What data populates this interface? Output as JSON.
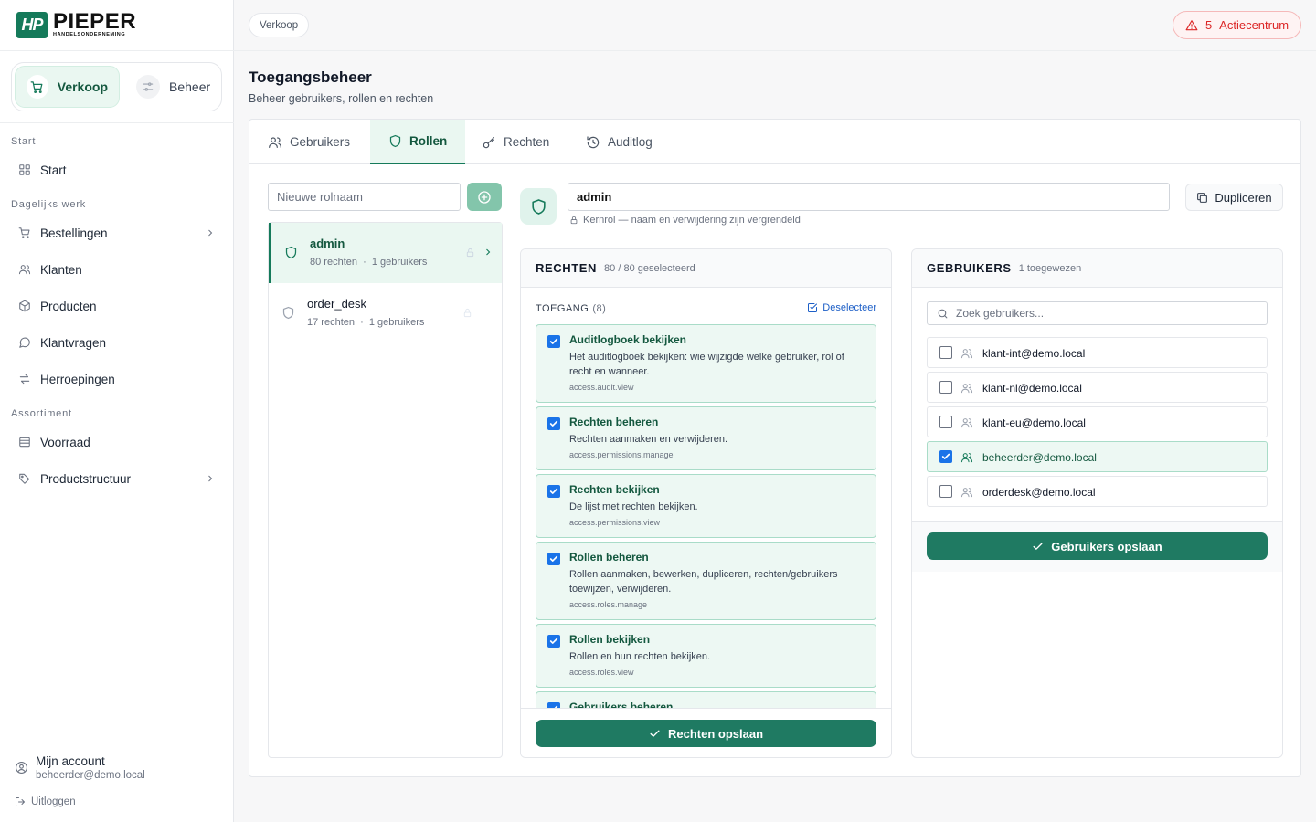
{
  "brand": {
    "mark": "HP",
    "name": "PIEPER",
    "tagline": "HANDELSONDERNEMING"
  },
  "switcher": {
    "sales": "Verkoop",
    "admin": "Beheer"
  },
  "sections": {
    "start": "Start",
    "daily": "Dagelijks werk",
    "assortment": "Assortiment"
  },
  "nav": {
    "start": "Start",
    "orders": "Bestellingen",
    "customers": "Klanten",
    "products": "Producten",
    "questions": "Klantvragen",
    "returns": "Herroepingen",
    "stock": "Voorraad",
    "structure": "Productstructuur"
  },
  "account": {
    "title": "Mijn account",
    "email": "beheerder@demo.local",
    "logout": "Uitloggen"
  },
  "breadcrumb": "Verkoop",
  "action_center": {
    "count": "5",
    "label": "Actiecentrum"
  },
  "page": {
    "title": "Toegangsbeheer",
    "subtitle": "Beheer gebruikers, rollen en rechten"
  },
  "tabs": {
    "users": "Gebruikers",
    "roles": "Rollen",
    "permissions": "Rechten",
    "audit": "Auditlog"
  },
  "new_role_placeholder": "Nieuwe rolnaam",
  "roles": [
    {
      "name": "admin",
      "perms": "80 rechten",
      "users": "1 gebruikers"
    },
    {
      "name": "order_desk",
      "perms": "17 rechten",
      "users": "1 gebruikers"
    }
  ],
  "selected_role": {
    "name": "admin",
    "hint": "Kernrol — naam en verwijdering zijn vergrendeld",
    "duplicate": "Dupliceren"
  },
  "rights_panel": {
    "title": "RECHTEN",
    "count": "80 / 80 geselecteerd",
    "group": "TOEGANG",
    "group_count": "(8)",
    "deselect": "Deselecteer",
    "save": "Rechten opslaan"
  },
  "permissions": [
    {
      "title": "Auditlogboek bekijken",
      "desc": "Het auditlogboek bekijken: wie wijzigde welke gebruiker, rol of recht en wanneer.",
      "key": "access.audit.view"
    },
    {
      "title": "Rechten beheren",
      "desc": "Rechten aanmaken en verwijderen.",
      "key": "access.permissions.manage"
    },
    {
      "title": "Rechten bekijken",
      "desc": "De lijst met rechten bekijken.",
      "key": "access.permissions.view"
    },
    {
      "title": "Rollen beheren",
      "desc": "Rollen aanmaken, bewerken, dupliceren, rechten/gebruikers toewijzen, verwijderen.",
      "key": "access.roles.manage"
    },
    {
      "title": "Rollen bekijken",
      "desc": "Rollen en hun rechten bekijken.",
      "key": "access.roles.view"
    },
    {
      "title": "Gebruikers beheren",
      "desc": "",
      "key": ""
    }
  ],
  "users_panel": {
    "title": "GEBRUIKERS",
    "count": "1 toegewezen",
    "search_placeholder": "Zoek gebruikers...",
    "save": "Gebruikers opslaan"
  },
  "users": [
    {
      "email": "klant-int@demo.local",
      "checked": false
    },
    {
      "email": "klant-nl@demo.local",
      "checked": false
    },
    {
      "email": "klant-eu@demo.local",
      "checked": false
    },
    {
      "email": "beheerder@demo.local",
      "checked": true
    },
    {
      "email": "orderdesk@demo.local",
      "checked": false
    }
  ],
  "colors": {
    "brand": "#157a5a",
    "accent_bg": "#eaf7f1",
    "primary_button": "#1f7a62",
    "checkbox": "#1a73e8",
    "alert": "#dc2626"
  }
}
